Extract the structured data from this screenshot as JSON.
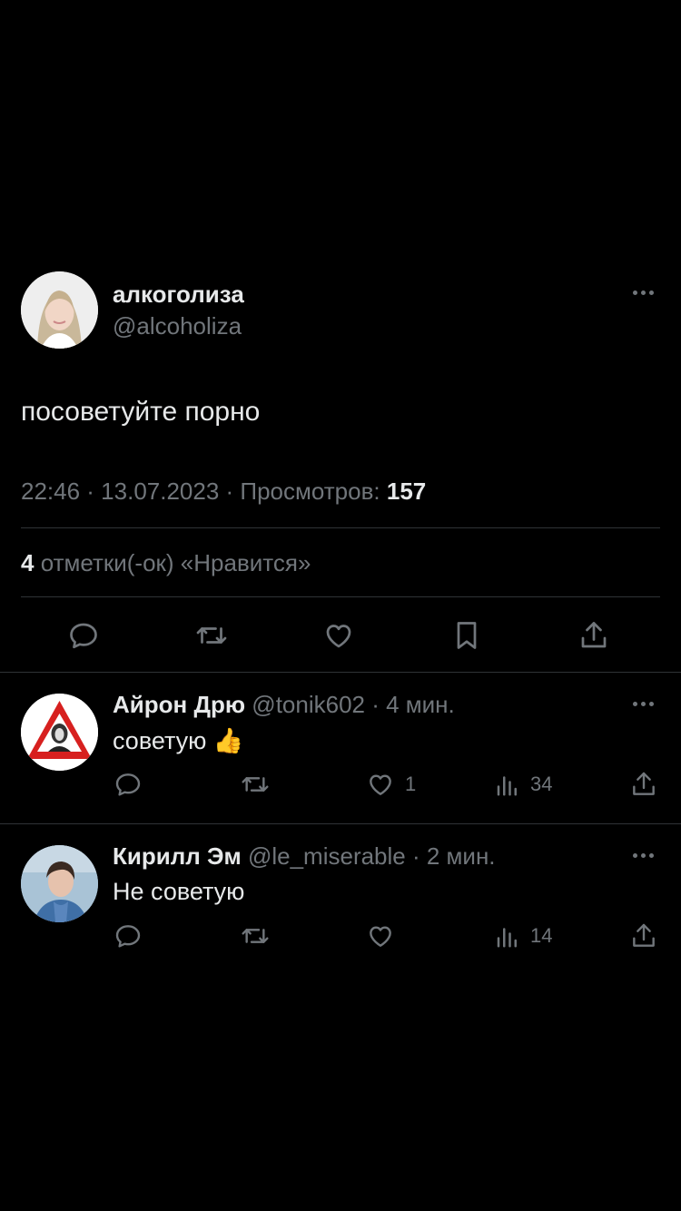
{
  "main_tweet": {
    "author_name": "алкоголиза",
    "handle": "@alcoholiza",
    "text": "посоветуйте порно",
    "meta_prefix": "22:46 · 13.07.2023 · Просмотров:",
    "views": "157",
    "likes_count": "4",
    "likes_label": "отметки(-ок) «Нравится»"
  },
  "replies": [
    {
      "author_name": "Айрон Дрю",
      "handle_time": "@tonik602 · 4 мин.",
      "text": "советую 👍",
      "likes": "1",
      "views": "34"
    },
    {
      "author_name": "Кирилл Эм",
      "handle_time": "@le_miserable · 2 мин.",
      "text": "Не советую",
      "likes": "",
      "views": "14"
    }
  ],
  "icons": [
    "reply-icon",
    "retweet-icon",
    "like-icon",
    "bookmark-icon",
    "share-icon",
    "views-icon",
    "more-icon"
  ]
}
